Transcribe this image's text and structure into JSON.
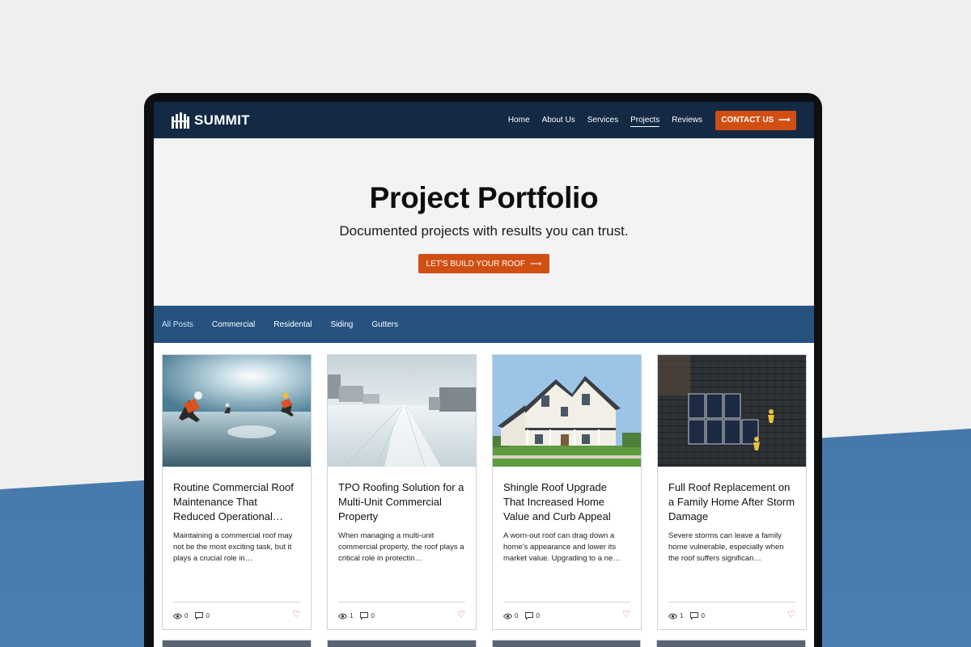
{
  "brand": {
    "name": "SUMMIT"
  },
  "nav": {
    "links": [
      "Home",
      "About Us",
      "Services",
      "Projects",
      "Reviews"
    ],
    "active": "Projects",
    "contact_label": "CONTACT US",
    "arrow": "⟶"
  },
  "hero": {
    "title": "Project Portfolio",
    "subtitle": "Documented projects with results you can trust.",
    "cta_label": "LET'S BUILD YOUR ROOF",
    "arrow": "⟶"
  },
  "filters": {
    "items": [
      "All Posts",
      "Commercial",
      "Residental",
      "Siding",
      "Gutters"
    ],
    "active": "All Posts"
  },
  "posts": [
    {
      "title": "Routine Commercial Roof Maintenance That Reduced Operational…",
      "excerpt": "Maintaining a commercial roof may not be the most exciting task, but it plays a crucial role in…",
      "views": "0",
      "comments": "0",
      "image": "workers-on-roof"
    },
    {
      "title": "TPO Roofing Solution for a Multi-Unit Commercial Property",
      "excerpt": "When managing a multi-unit commercial property, the roof plays a critical role in protectin…",
      "views": "1",
      "comments": "0",
      "image": "white-tpo-roof"
    },
    {
      "title": "Shingle Roof Upgrade That Increased Home Value and Curb Appeal",
      "excerpt": "A worn-out roof can drag down a home's appearance and lower its market value. Upgrading to a ne…",
      "views": "0",
      "comments": "0",
      "image": "suburban-house"
    },
    {
      "title": "Full Roof Replacement on a Family Home After Storm Damage",
      "excerpt": "Severe storms can leave a family home vulnerable, especially when the roof suffers significan…",
      "views": "1",
      "comments": "0",
      "image": "roof-with-solar-panels"
    }
  ],
  "colors": {
    "nav_bg": "#132944",
    "accent": "#d24f14",
    "filter_bg": "#25527f",
    "heart": "#e0393e"
  }
}
